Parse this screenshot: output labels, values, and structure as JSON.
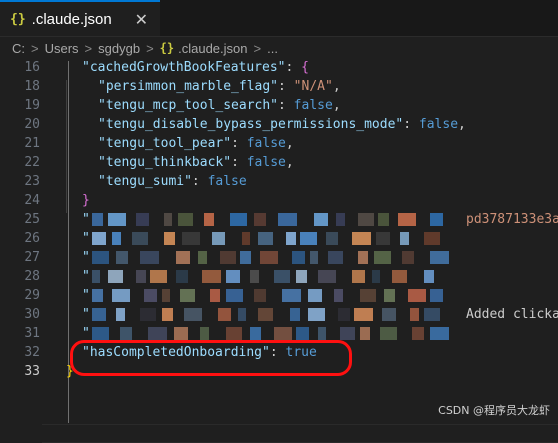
{
  "tab": {
    "icon": "json-braces-icon",
    "braces": "{}",
    "label": ".claude.json",
    "close_glyph": "✕"
  },
  "breadcrumb": {
    "items": [
      "C:",
      "Users",
      "sgdygb",
      ".claude.json",
      "..."
    ],
    "separator": ">",
    "file_icon": "{}"
  },
  "editor": {
    "lines": [
      {
        "num": "16",
        "indent": "  ",
        "tokens": [
          {
            "t": "\"cachedGrowthBookFeatures\"",
            "c": "k"
          },
          {
            "t": ": ",
            "c": "p"
          },
          {
            "t": "{",
            "c": "br1"
          }
        ]
      },
      {
        "num": "18",
        "indent": "    ",
        "tokens": [
          {
            "t": "\"persimmon_marble_flag\"",
            "c": "k"
          },
          {
            "t": ": ",
            "c": "p"
          },
          {
            "t": "\"N/A\"",
            "c": "s"
          },
          {
            "t": ",",
            "c": "p"
          }
        ]
      },
      {
        "num": "19",
        "indent": "    ",
        "tokens": [
          {
            "t": "\"tengu_mcp_tool_search\"",
            "c": "k"
          },
          {
            "t": ": ",
            "c": "p"
          },
          {
            "t": "false",
            "c": "b"
          },
          {
            "t": ",",
            "c": "p"
          }
        ]
      },
      {
        "num": "20",
        "indent": "    ",
        "tokens": [
          {
            "t": "\"tengu_disable_bypass_permissions_mode\"",
            "c": "k"
          },
          {
            "t": ": ",
            "c": "p"
          },
          {
            "t": "false",
            "c": "b"
          },
          {
            "t": ",",
            "c": "p"
          }
        ]
      },
      {
        "num": "21",
        "indent": "    ",
        "tokens": [
          {
            "t": "\"tengu_tool_pear\"",
            "c": "k"
          },
          {
            "t": ": ",
            "c": "p"
          },
          {
            "t": "false",
            "c": "b"
          },
          {
            "t": ",",
            "c": "p"
          }
        ]
      },
      {
        "num": "22",
        "indent": "    ",
        "tokens": [
          {
            "t": "\"tengu_thinkback\"",
            "c": "k"
          },
          {
            "t": ": ",
            "c": "p"
          },
          {
            "t": "false",
            "c": "b"
          },
          {
            "t": ",",
            "c": "p"
          }
        ]
      },
      {
        "num": "23",
        "indent": "    ",
        "tokens": [
          {
            "t": "\"tengu_sumi\"",
            "c": "k"
          },
          {
            "t": ": ",
            "c": "p"
          },
          {
            "t": "false",
            "c": "b"
          }
        ]
      },
      {
        "num": "24",
        "indent": "  ",
        "tokens": [
          {
            "t": "}",
            "c": "br1"
          }
        ]
      },
      {
        "num": "25",
        "indent": "  ",
        "tokens": [
          {
            "t": "\"",
            "c": "k"
          }
        ],
        "blur": true,
        "tail": "pd3787133e3a",
        "tail_color": "s"
      },
      {
        "num": "26",
        "indent": "  ",
        "tokens": [
          {
            "t": "\"",
            "c": "k"
          }
        ],
        "blur": true
      },
      {
        "num": "27",
        "indent": "  ",
        "tokens": [
          {
            "t": "\"",
            "c": "k"
          }
        ],
        "blur": true
      },
      {
        "num": "28",
        "indent": "  ",
        "tokens": [
          {
            "t": "\"",
            "c": "k"
          }
        ],
        "blur": true
      },
      {
        "num": "29",
        "indent": "  ",
        "tokens": [
          {
            "t": "\"",
            "c": "k"
          }
        ],
        "blur": true
      },
      {
        "num": "30",
        "indent": "  ",
        "tokens": [
          {
            "t": "\"",
            "c": "k"
          }
        ],
        "blur": true,
        "tail": "Added clicka",
        "tail_color": "p"
      },
      {
        "num": "31",
        "indent": "  ",
        "tokens": [
          {
            "t": "\"",
            "c": "k"
          }
        ],
        "blur": true
      },
      {
        "num": "32",
        "indent": "  ",
        "tokens": [
          {
            "t": "\"hasCompletedOnboarding\"",
            "c": "k"
          },
          {
            "t": ": ",
            "c": "p"
          },
          {
            "t": "true",
            "c": "b"
          }
        ]
      },
      {
        "num": "33",
        "indent": "",
        "tokens": [
          {
            "t": "}",
            "c": "br0"
          }
        ],
        "active": true
      }
    ]
  },
  "annotation": {
    "color": "#ff1010",
    "target": "hasCompletedOnboarding"
  },
  "watermark": "CSDN @程序员大龙虾",
  "colors": {
    "accent": "#0078d4",
    "key": "#9cdcfe",
    "string": "#ce9178",
    "bool": "#569cd6"
  }
}
